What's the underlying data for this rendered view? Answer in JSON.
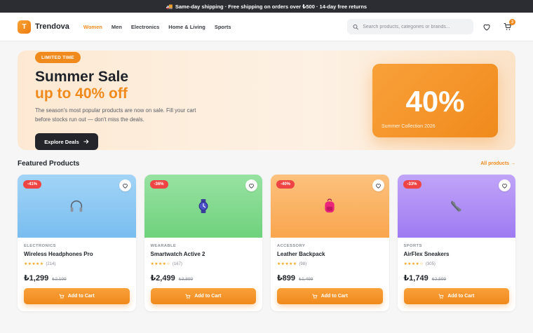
{
  "topbar": {
    "icon": "truck-icon",
    "text": "Same-day shipping · Free shipping on orders over ₺500 · 14-day free returns"
  },
  "header": {
    "logo_letter": "T",
    "logo_text": "Trendova",
    "nav": [
      {
        "label": "Women",
        "active": true
      },
      {
        "label": "Men",
        "active": false
      },
      {
        "label": "Electronics",
        "active": false
      },
      {
        "label": "Home & Living",
        "active": false
      },
      {
        "label": "Sports",
        "active": false
      }
    ],
    "search_placeholder": "Search products, categories or brands...",
    "cart_count": "3"
  },
  "hero": {
    "tag": "LIMITED TIME",
    "title_line1": "Summer Sale",
    "title_line2": "up to 40% off",
    "description": "The season's most popular products are now on sale. Fill your cart before stocks run out — don't miss the deals.",
    "button_label": "Explore Deals",
    "promo_big": "40%",
    "promo_caption": "Summer Collection 2026"
  },
  "featured": {
    "title": "Featured Products",
    "link": "All products →",
    "add_label": "Add to Cart",
    "products": [
      {
        "discount": "-41%",
        "category": "ELECTRONICS",
        "name": "Wireless Headphones Pro",
        "stars": "★★★★★",
        "reviews": "(214)",
        "price": "₺1,299",
        "old_price": "₺2,199",
        "icon": "headphones-icon",
        "bg": "#8cc8f2"
      },
      {
        "discount": "-36%",
        "category": "WEARABLE",
        "name": "Smartwatch Active 2",
        "stars": "★★★★☆",
        "reviews": "(167)",
        "price": "₺2,499",
        "old_price": "₺3,899",
        "icon": "watch-icon",
        "bg": "#7fd98a"
      },
      {
        "discount": "-40%",
        "category": "ACCESSORY",
        "name": "Leather Backpack",
        "stars": "★★★★★",
        "reviews": "(98)",
        "price": "₺899",
        "old_price": "₺1,499",
        "icon": "backpack-icon",
        "bg": "#fbb468"
      },
      {
        "discount": "-33%",
        "category": "SPORTS",
        "name": "AirFlex Sneakers",
        "stars": "★★★★☆",
        "reviews": "(305)",
        "price": "₺1,749",
        "old_price": "₺2,599",
        "icon": "sneaker-icon",
        "bg": "#b08ef5"
      }
    ]
  },
  "colors": {
    "accent": "#f08a1c",
    "dark": "#23252b",
    "discount": "#ef4444"
  }
}
